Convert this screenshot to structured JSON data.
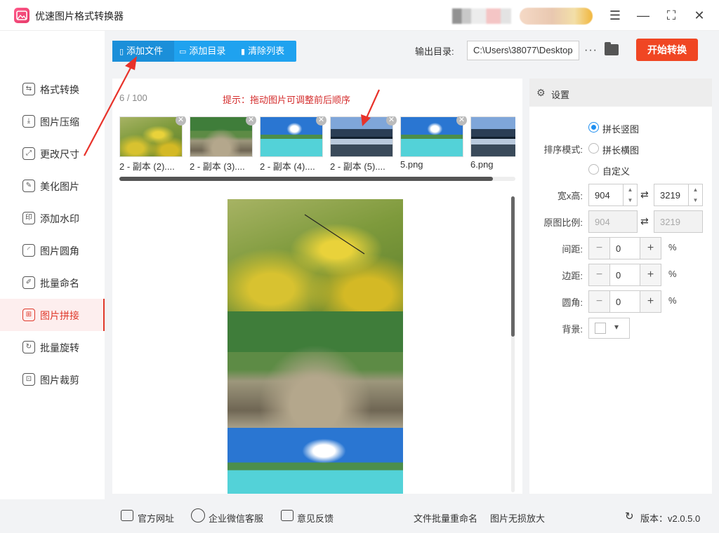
{
  "app": {
    "title": "优速图片格式转换器"
  },
  "sidebar": {
    "items": [
      {
        "label": "格式转换",
        "icon": "format-convert-icon",
        "glyph": "⇆"
      },
      {
        "label": "图片压缩",
        "icon": "compress-icon",
        "glyph": "⤓"
      },
      {
        "label": "更改尺寸",
        "icon": "resize-icon",
        "glyph": "⤢"
      },
      {
        "label": "美化图片",
        "icon": "beautify-icon",
        "glyph": "✎"
      },
      {
        "label": "添加水印",
        "icon": "watermark-icon",
        "glyph": "印"
      },
      {
        "label": "图片圆角",
        "icon": "rounded-corner-icon",
        "glyph": "◜"
      },
      {
        "label": "批量命名",
        "icon": "rename-icon",
        "glyph": "✐"
      },
      {
        "label": "图片拼接",
        "icon": "stitch-icon",
        "glyph": "⊞"
      },
      {
        "label": "批量旋转",
        "icon": "rotate-icon",
        "glyph": "↻"
      },
      {
        "label": "图片裁剪",
        "icon": "crop-icon",
        "glyph": "⊡"
      }
    ],
    "active_index": 7
  },
  "toolbar": {
    "add_file": "添加文件",
    "add_folder": "添加目录",
    "clear_list": "清除列表",
    "output_label": "输出目录:",
    "output_path": "C:\\Users\\38077\\Desktop",
    "start": "开始转换"
  },
  "main": {
    "count": "6 / 100",
    "hint": "提示：拖动图片可调整前后顺序",
    "thumbnails": [
      {
        "name": "2 - 副本 (2)....",
        "image": "flower"
      },
      {
        "name": "2 - 副本 (3)....",
        "image": "river"
      },
      {
        "name": "2 - 副本 (4)....",
        "image": "beach"
      },
      {
        "name": "2 - 副本 (5)....",
        "image": "mountain"
      },
      {
        "name": "5.png",
        "image": "beach"
      },
      {
        "name": "6.png",
        "image": "mountain"
      }
    ]
  },
  "settings": {
    "header": "设置",
    "sort_label": "排序模式:",
    "sort_options": [
      "拼长竖图",
      "拼长横图",
      "自定义"
    ],
    "sort_selected": 0,
    "size_label": "宽x高:",
    "width": "904",
    "height": "3219",
    "ratio_label": "原图比例:",
    "ratio_width": "904",
    "ratio_height": "3219",
    "spacing_label": "间距:",
    "spacing": "0",
    "margin_label": "边距:",
    "margin": "0",
    "radius_label": "圆角:",
    "radius": "0",
    "percent": "%",
    "bg_label": "背景:",
    "bg_color": "#ffffff"
  },
  "footer": {
    "website": "官方网址",
    "wechat": "企业微信客服",
    "feedback": "意见反馈",
    "batch_rename": "文件批量重命名",
    "upscale": "图片无损放大",
    "version": "版本：v2.0.5.0"
  },
  "colors": {
    "accent": "#1fa2ef",
    "start": "#f04623",
    "active": "#e0392b",
    "hint": "#d42c2c"
  }
}
